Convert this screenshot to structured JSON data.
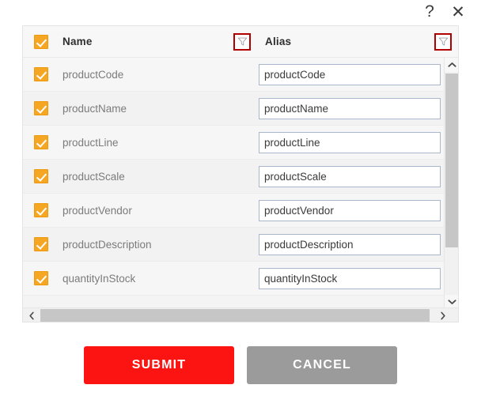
{
  "titlebar": {
    "help_icon": "question-mark-icon",
    "help_label": "?",
    "close_icon": "close-icon",
    "close_label": "✕"
  },
  "grid": {
    "select_all_checked": true,
    "columns": [
      {
        "key": "name",
        "label": "Name",
        "filter_icon": "filter-funnel-icon",
        "filter_highlighted": true
      },
      {
        "key": "alias",
        "label": "Alias",
        "filter_icon": "filter-funnel-icon",
        "filter_highlighted": true
      }
    ],
    "rows": [
      {
        "checked": true,
        "name": "productCode",
        "alias": "productCode"
      },
      {
        "checked": true,
        "name": "productName",
        "alias": "productName"
      },
      {
        "checked": true,
        "name": "productLine",
        "alias": "productLine"
      },
      {
        "checked": true,
        "name": "productScale",
        "alias": "productScale"
      },
      {
        "checked": true,
        "name": "productVendor",
        "alias": "productVendor"
      },
      {
        "checked": true,
        "name": "productDescription",
        "alias": "productDescription"
      },
      {
        "checked": true,
        "name": "quantityInStock",
        "alias": "quantityInStock"
      }
    ]
  },
  "scrollbars": {
    "vertical": {
      "up_label": "⌃",
      "down_label": "⌄"
    },
    "horizontal": {
      "left_label": "‹",
      "right_label": "›"
    }
  },
  "footer": {
    "submit_label": "Submit",
    "cancel_label": "Cancel"
  },
  "colors": {
    "submit_red": "#fb1412",
    "cancel_grey": "#9b9b9b",
    "checkbox_orange": "#f5a623",
    "filter_highlight_red": "#b20000",
    "input_border": "#aab6cb",
    "row_text": "#7b7b7b"
  }
}
